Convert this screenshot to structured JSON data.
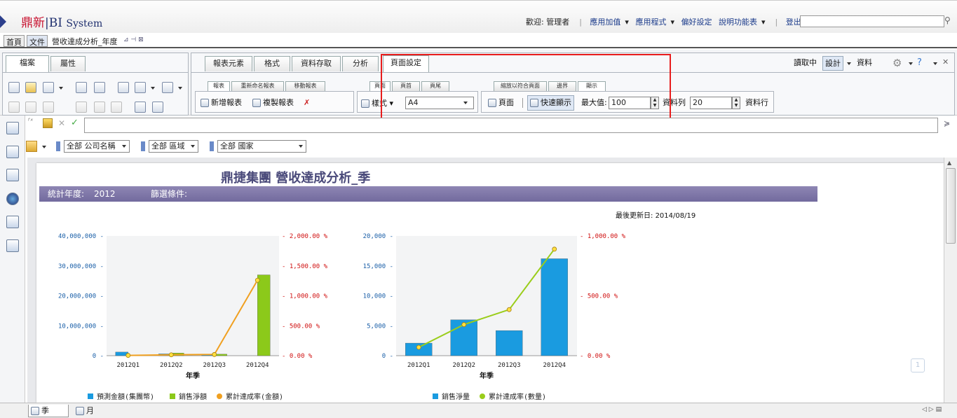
{
  "header": {
    "brand_main": "鼎新",
    "brand_sep": "|",
    "brand_bi": "BI",
    "brand_system": "System",
    "welcome": "歡迎: 管理者",
    "menu_addons": "應用加值",
    "menu_apps": "應用程式",
    "menu_prefs": "偏好設定",
    "menu_help": "說明功能表",
    "logout": "登出",
    "search_value": ""
  },
  "doc_tabs": {
    "home": "首頁",
    "document": "文件",
    "current": "營收達成分析_年度"
  },
  "left_panel": {
    "tab_file": "檔案",
    "tab_props": "屬性"
  },
  "ribbon": {
    "tabs": [
      "報表元素",
      "格式",
      "資料存取",
      "分析",
      "頁面設定"
    ],
    "active_tab": "頁面設定",
    "subtabs_report": [
      "報表",
      "重新命名報表",
      "移動報表"
    ],
    "subtabs_page": [
      "頁面",
      "頁首",
      "頁尾"
    ],
    "subtabs_display": [
      "縮放以符合頁面",
      "邊界",
      "顯示"
    ],
    "new_report": "新增報表",
    "copy_report": "複製報表",
    "style_label": "樣式",
    "paper_size": "A4",
    "page_btn": "頁面",
    "quick_display": "快速顯示",
    "max_label": "最大值:",
    "max_value": "100",
    "rows_label": "資料列",
    "rows_value": "20",
    "rows_suffix": "資料行"
  },
  "mode": {
    "reading": "讀取中",
    "design": "設計",
    "data": "資料"
  },
  "filters": [
    {
      "label": "全部 公司名稱"
    },
    {
      "label": "全部 區域"
    },
    {
      "label": "全部 國家"
    }
  ],
  "report": {
    "title": "鼎捷集團 營收達成分析_季",
    "year_label": "統計年度:",
    "year_value": "2012",
    "filter_label": "篩選條件:",
    "updated_label": "最後更新日:",
    "updated_value": "2014/08/19"
  },
  "bottom_tabs": [
    "季",
    "月"
  ],
  "chart_data": [
    {
      "type": "bar",
      "categories": [
        "2012Q1",
        "2012Q2",
        "2012Q3",
        "2012Q4"
      ],
      "xlabel": "年季",
      "ylim": [
        0,
        40000000
      ],
      "y_ticks": [
        "0",
        "10,000,000",
        "20,000,000",
        "30,000,000",
        "40,000,000"
      ],
      "y2lim": [
        0,
        2000
      ],
      "y2_ticks": [
        "0.00 %",
        "500.00 %",
        "1,000.00 %",
        "1,500.00 %",
        "2,000.00 %"
      ],
      "series": [
        {
          "name": "預測金額(集團幣)",
          "kind": "bar",
          "color": "#1a9be0",
          "values": [
            1200000,
            600000,
            300000,
            0
          ]
        },
        {
          "name": "銷售淨額",
          "kind": "bar",
          "color": "#8cc91a",
          "values": [
            0,
            900000,
            500000,
            27000000
          ]
        },
        {
          "name": "累計達成率(金額)",
          "kind": "line",
          "axis": "y2",
          "color": "#f0a020",
          "values": [
            5,
            15,
            20,
            1260
          ]
        }
      ]
    },
    {
      "type": "bar",
      "categories": [
        "2012Q1",
        "2012Q2",
        "2012Q3",
        "2012Q4"
      ],
      "xlabel": "年季",
      "ylim": [
        0,
        20000
      ],
      "y_ticks": [
        "0",
        "5,000",
        "10,000",
        "15,000",
        "20,000"
      ],
      "y2lim": [
        0,
        1000
      ],
      "y2_ticks": [
        "0.00 %",
        "500.00 %",
        "1,000.00 %"
      ],
      "series": [
        {
          "name": "銷售淨量",
          "kind": "bar",
          "color": "#1a9be0",
          "values": [
            2100,
            6000,
            4200,
            16200
          ]
        },
        {
          "name": "累計達成率(數量)",
          "kind": "line",
          "axis": "y2",
          "color": "#9acd1a",
          "values": [
            70,
            260,
            385,
            890
          ]
        }
      ]
    }
  ]
}
